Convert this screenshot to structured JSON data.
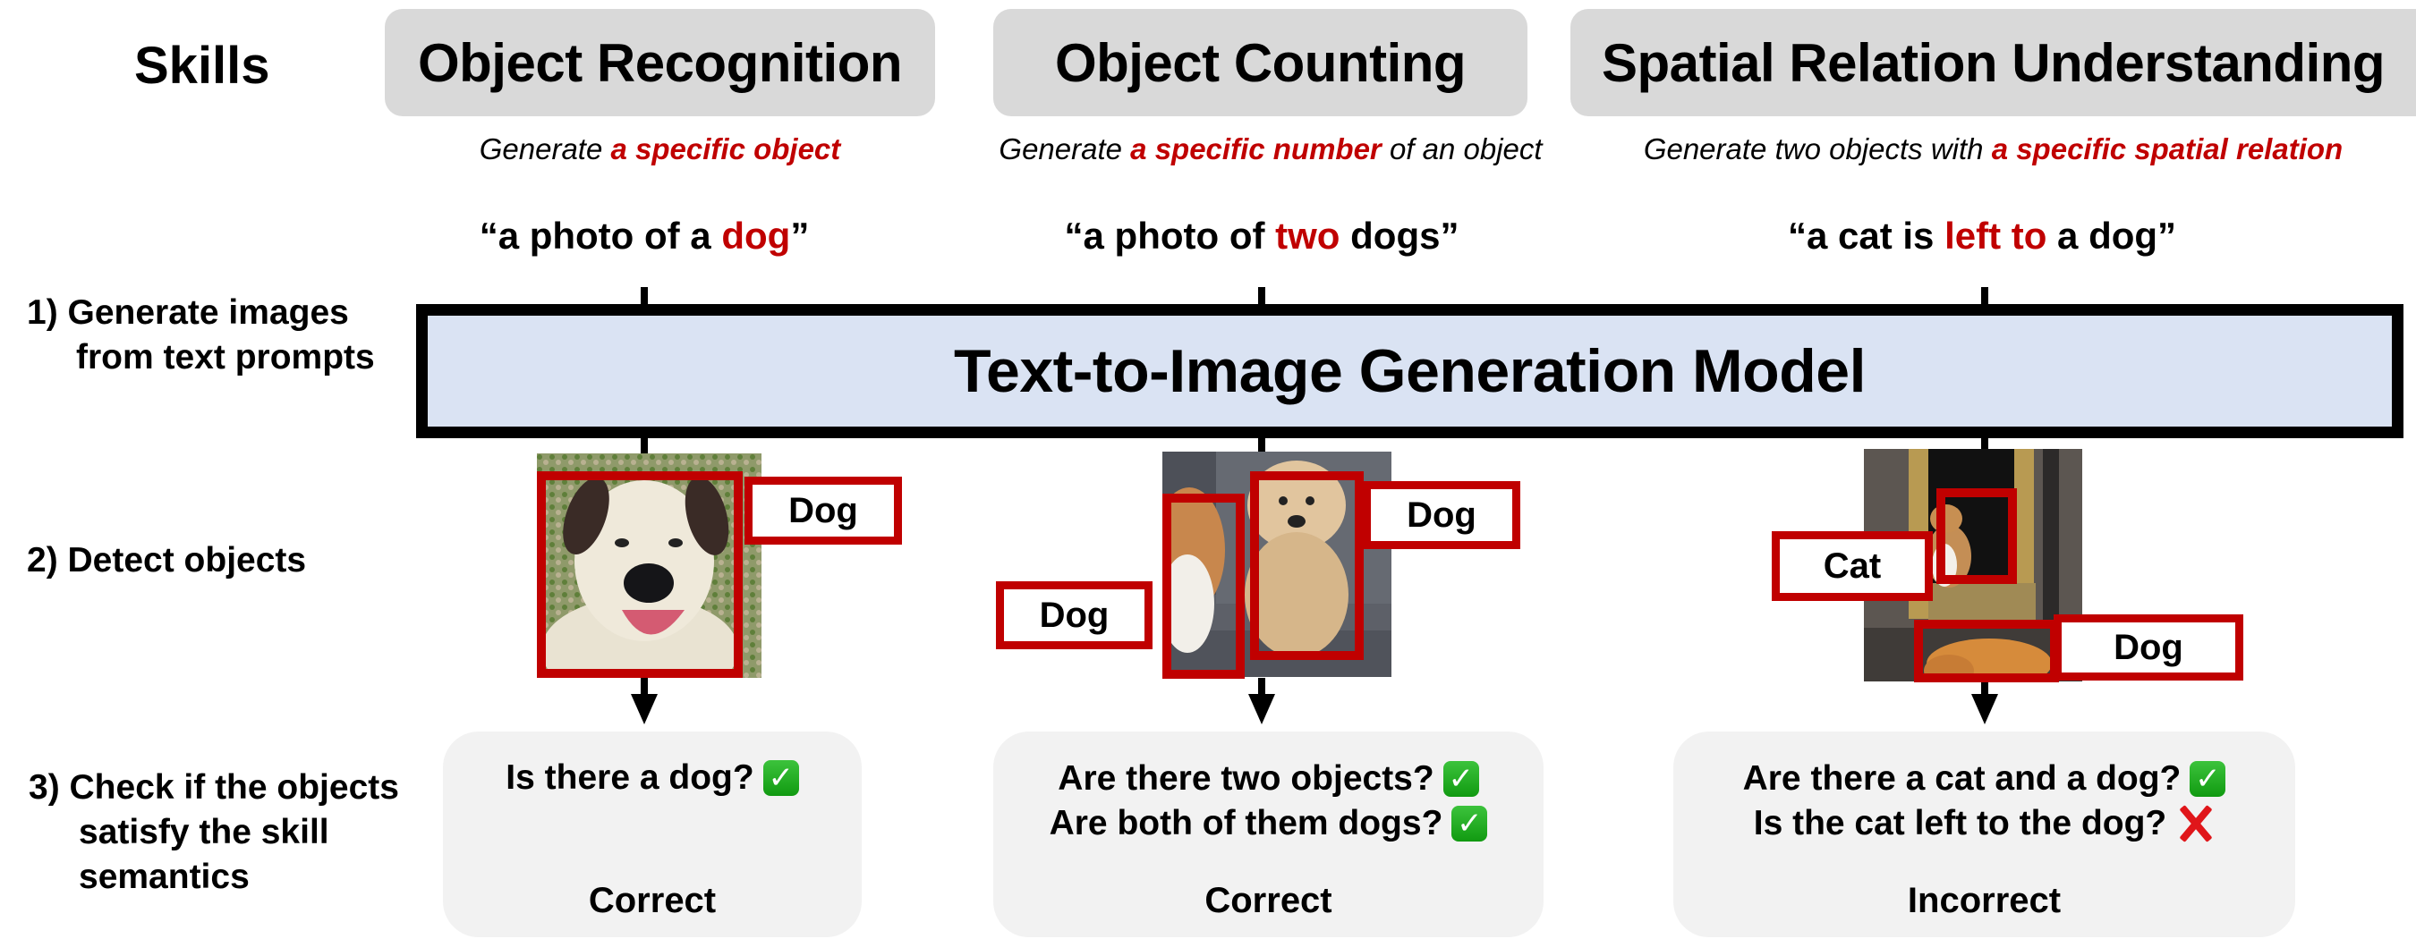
{
  "header": {
    "skills_label": "Skills"
  },
  "steps": {
    "step1_line1": "1) Generate images",
    "step1_line2": "from text prompts",
    "step2": "2) Detect objects",
    "step3_line1": "3) Check if the objects",
    "step3_line2": "satisfy the skill",
    "step3_line3": "semantics"
  },
  "model": {
    "title": "Text-to-Image Generation Model"
  },
  "columns": [
    {
      "skill": "Object Recognition",
      "desc_pre": "Generate ",
      "desc_hl": "a specific object",
      "desc_post": "",
      "prompt_pre": "“a photo of a ",
      "prompt_hl": "dog",
      "prompt_post": "”",
      "detections": [
        "Dog"
      ],
      "questions": [
        {
          "text": "Is there a dog?",
          "result": "check-icon"
        }
      ],
      "verdict": "Correct"
    },
    {
      "skill": "Object Counting",
      "desc_pre": "Generate ",
      "desc_hl": "a specific number",
      "desc_post": " of an object",
      "prompt_pre": "“a photo of ",
      "prompt_hl": "two",
      "prompt_post": " dogs”",
      "detections": [
        "Dog",
        "Dog"
      ],
      "questions": [
        {
          "text": "Are there two objects?",
          "result": "check-icon"
        },
        {
          "text": "Are both of them dogs?",
          "result": "check-icon"
        }
      ],
      "verdict": "Correct"
    },
    {
      "skill": "Spatial Relation Understanding",
      "desc_pre": "Generate two objects with ",
      "desc_hl": "a specific spatial relation",
      "desc_post": "",
      "prompt_pre": "“a cat is ",
      "prompt_hl": "left to",
      "prompt_post": " a dog”",
      "detections": [
        "Cat",
        "Dog"
      ],
      "questions": [
        {
          "text": "Are there a cat and a dog?",
          "result": "check-icon"
        },
        {
          "text": "Is the cat left to the dog?",
          "result": "cross-icon"
        }
      ],
      "verdict": "Incorrect"
    }
  ],
  "icons": {
    "check": "✓"
  },
  "colors": {
    "accent_red": "#C00000",
    "model_fill": "#DAE3F3",
    "header_fill": "#D9D9D9",
    "result_fill": "#F2F2F2",
    "check_green": "#22AA22",
    "cross_red": "#E0161A"
  }
}
